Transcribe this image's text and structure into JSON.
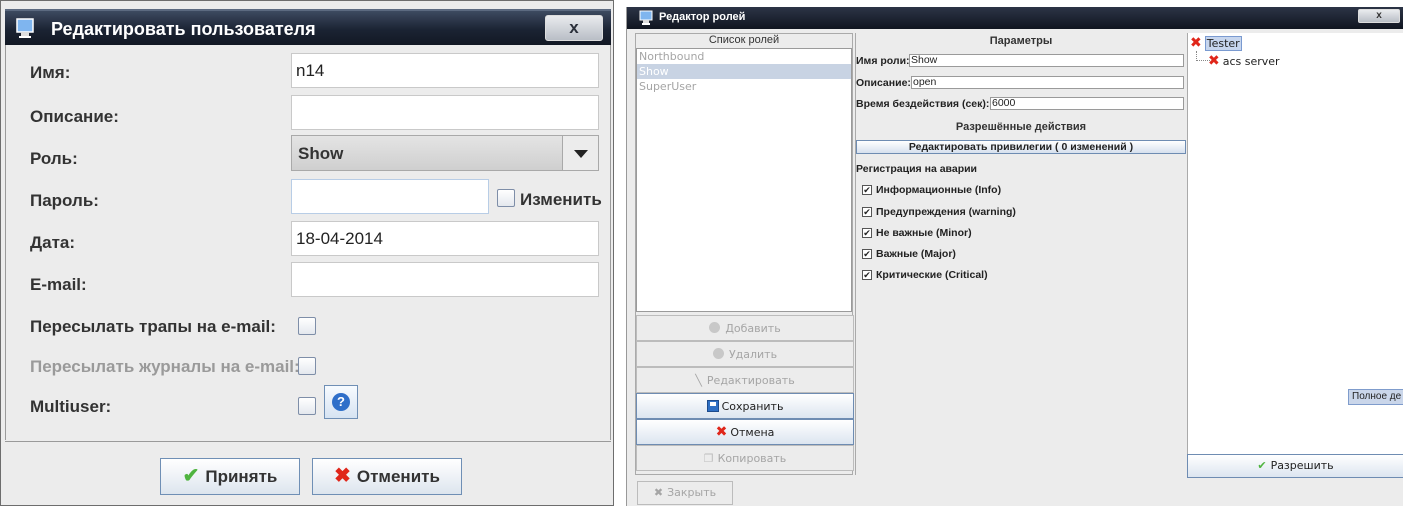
{
  "edit_user": {
    "title": "Редактировать пользователя",
    "close_glyph": "x",
    "fields": {
      "name_label": "Имя:",
      "name_value": "n14",
      "desc_label": "Описание:",
      "desc_value": "",
      "role_label": "Роль:",
      "role_value": "Show",
      "password_label": "Пароль:",
      "password_value": "",
      "change_label": "Изменить",
      "date_label": "Дата:",
      "date_value": "18-04-2014",
      "email_label": "E-mail:",
      "email_value": "",
      "forward_traps_label": "Пересылать трапы на e-mail:",
      "forward_logs_label": "Пересылать журналы на e-mail:",
      "multiuser_label": "Multiuser:"
    },
    "buttons": {
      "accept_label": "Принять",
      "cancel_label": "Отменить"
    }
  },
  "role_editor": {
    "title": "Редактор ролей",
    "close_glyph": "x",
    "roles_header": "Список ролей",
    "roles": [
      "Northbound",
      "Show",
      "SuperUser"
    ],
    "selected_role": "Show",
    "buttons": {
      "add": "Добавить",
      "delete": "Удалить",
      "edit": "Редактировать",
      "save": "Сохранить",
      "cancel": "Отмена",
      "copy": "Копировать",
      "close": "Закрыть",
      "allow": "Разрешить"
    },
    "params": {
      "header": "Параметры",
      "role_name_label": "Имя роли:",
      "role_name_value": "Show",
      "description_label": "Описание:",
      "description_value": "open",
      "idle_label": "Время бездействия (сек):",
      "idle_value": "6000",
      "allowed_actions_header": "Разрешённые действия",
      "edit_privileges_label": "Редактировать привилегии ( 0 изменений )",
      "alarm_reg_header": "Регистрация на аварии",
      "alarms": [
        {
          "label": "Информационные (Info)",
          "checked": true
        },
        {
          "label": "Предупреждения (warning)",
          "checked": true
        },
        {
          "label": "Не важные (Minor)",
          "checked": true
        },
        {
          "label": "Важные (Major)",
          "checked": true
        },
        {
          "label": "Критические (Critical)",
          "checked": true
        }
      ]
    },
    "tree": {
      "root": "Tester",
      "child": "acs server",
      "full_tag": "Полное де"
    }
  },
  "colors": {
    "title_bar": "#1b2333",
    "selection": "#c8d3e3",
    "accent_blue": "#2f6fc9",
    "ok_green": "#4fb43f",
    "cancel_red": "#e0261a"
  }
}
